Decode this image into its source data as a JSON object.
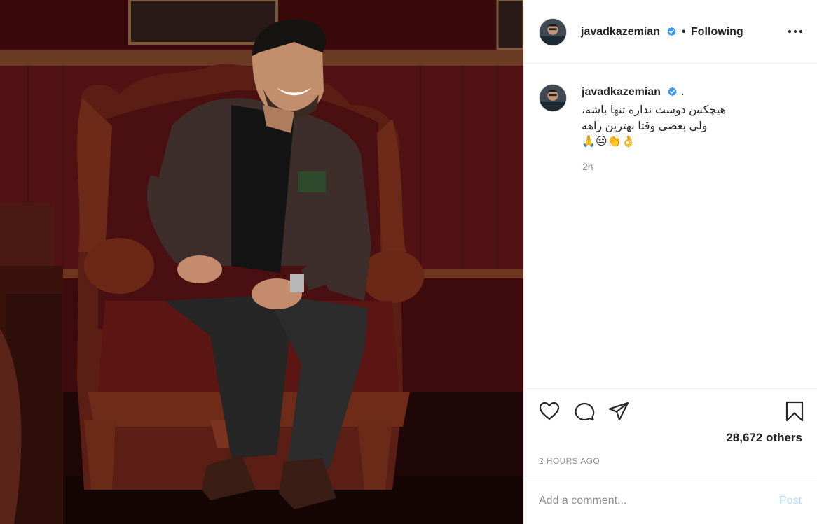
{
  "post": {
    "username": "javadkazemian",
    "follow_separator": "•",
    "follow_status": "Following",
    "caption": {
      "username": "javadkazemian",
      "suffix": ".",
      "line1": "هیچکس دوست نداره تنها باشه،",
      "line2": "ولی بعضی وقتا بهترین راهه",
      "line3": "👌👏😔🙏"
    },
    "caption_time": "2h",
    "likes": "28,672 others",
    "posted_time": "2 HOURS AGO"
  },
  "comment": {
    "placeholder": "Add a comment...",
    "post_label": "Post"
  },
  "icons": {
    "verified": "verified-badge-icon",
    "more": "more-options-icon",
    "like": "heart-icon",
    "comment": "comment-icon",
    "share": "direct-share-icon",
    "save": "bookmark-icon"
  },
  "colors": {
    "verified": "#3897f0",
    "post_disabled": "#b2dffc",
    "muted": "#8e8e8e",
    "text": "#262626"
  }
}
